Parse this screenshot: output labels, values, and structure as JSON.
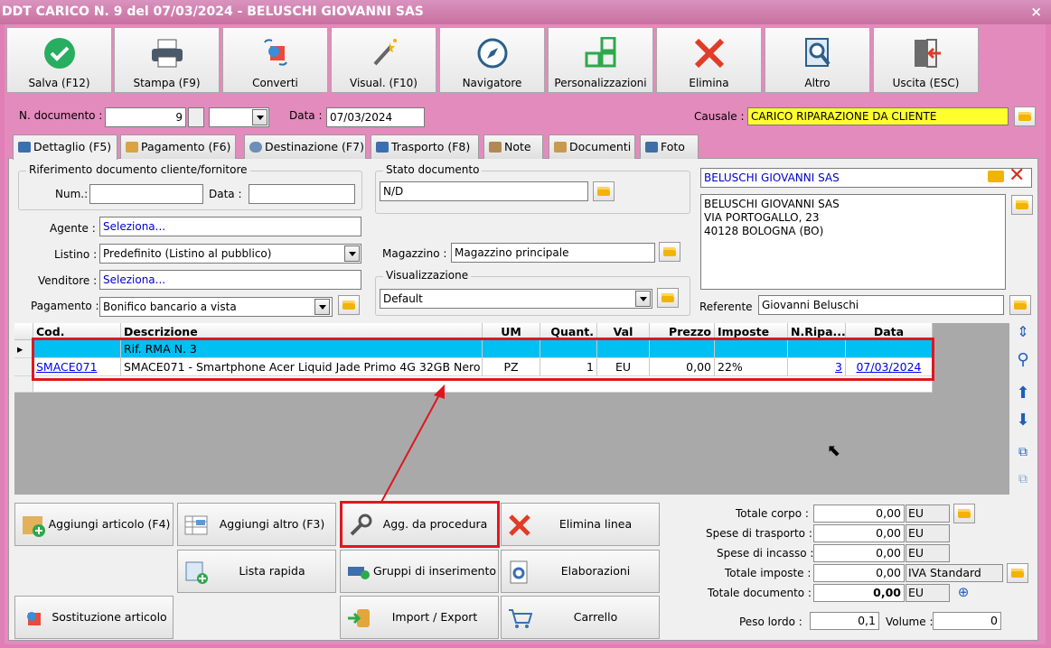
{
  "window": {
    "title": "DDT CARICO N. 9 del 07/03/2024 - BELUSCHI GIOVANNI SAS",
    "close": "×"
  },
  "toolbar": {
    "salva": "Salva (F12)",
    "stampa": "Stampa (F9)",
    "converti": "Converti",
    "visual": "Visual. (F10)",
    "navigatore": "Navigatore",
    "personalizzazioni": "Personalizzazioni",
    "elimina": "Elimina",
    "altro": "Altro",
    "uscita": "Uscita (ESC)"
  },
  "header": {
    "ndoc_label": "N. documento :",
    "ndoc_value": "9",
    "data_label": "Data :",
    "data_value": "07/03/2024",
    "causale_label": "Causale :",
    "causale_value": "CARICO RIPARAZIONE DA CLIENTE"
  },
  "tabs": [
    "Dettaglio (F5)",
    "Pagamento (F6)",
    "Destinazione (F7)",
    "Trasporto (F8)",
    "Note",
    "Documenti",
    "Foto"
  ],
  "form": {
    "rif_title": "Riferimento documento cliente/fornitore",
    "num_label": "Num.:",
    "num_value": "",
    "rdata_label": "Data :",
    "rdata_value": "",
    "agente_label": "Agente :",
    "agente_value": "Seleziona...",
    "listino_label": "Listino :",
    "listino_value": "Predefinito (Listino al pubblico)",
    "venditore_label": "Venditore :",
    "venditore_value": "Seleziona...",
    "pagamento_label": "Pagamento :",
    "pagamento_value": "Bonifico bancario a vista",
    "stato_title": "Stato documento",
    "stato_value": "N/D",
    "magazzino_label": "Magazzino :",
    "magazzino_value": "Magazzino principale",
    "visual_title": "Visualizzazione",
    "visual_value": "Default",
    "cliente_name": "BELUSCHI GIOVANNI SAS",
    "address_line1": "BELUSCHI GIOVANNI SAS",
    "address_line2": "VIA PORTOGALLO, 23",
    "address_line3": "40128 BOLOGNA (BO)",
    "referente_label": "Referente",
    "referente_value": "Giovanni Beluschi"
  },
  "grid": {
    "columns": [
      "Cod.",
      "Descrizione",
      "UM",
      "Quant.",
      "Val",
      "Prezzo",
      "Imposte",
      "N.Ripa...",
      "Data"
    ],
    "rows": [
      {
        "cod": "",
        "descr": "Rif. RMA N. 3",
        "um": "",
        "quant": "",
        "val": "",
        "prezzo": "",
        "imposte": "",
        "nrip": "",
        "data": ""
      },
      {
        "cod": "SMACE071",
        "descr": "SMACE071 - Smartphone Acer Liquid Jade Primo 4G 32GB Nero",
        "um": "PZ",
        "quant": "1",
        "val": "EU",
        "prezzo": "0,00",
        "imposte": "22%",
        "nrip": "3",
        "data": "07/03/2024"
      }
    ]
  },
  "buttons": {
    "aggiungi_articolo": "Aggiungi articolo (F4)",
    "aggiungi_altro": "Aggiungi altro (F3)",
    "agg_procedura": "Agg. da procedura",
    "elimina_linea": "Elimina linea",
    "lista_rapida": "Lista rapida",
    "gruppi": "Gruppi di inserimento",
    "elaborazioni": "Elaborazioni",
    "sostituzione": "Sostituzione articolo",
    "import_export": "Import / Export",
    "carrello": "Carrello"
  },
  "totals": {
    "corpo_label": "Totale corpo :",
    "corpo_value": "0,00",
    "corpo_cur": "EU",
    "trasporto_label": "Spese di trasporto :",
    "trasporto_value": "0,00",
    "trasporto_cur": "EU",
    "incasso_label": "Spese di incasso :",
    "incasso_value": "0,00",
    "incasso_cur": "EU",
    "imposte_label": "Totale imposte :",
    "imposte_value": "0,00",
    "imposte_cur": "IVA Standard",
    "documento_label": "Totale documento :",
    "documento_value": "0,00",
    "documento_cur": "EU",
    "peso_label": "Peso lordo :",
    "peso_value": "0,1",
    "volume_label": "Volume :",
    "volume_value": "0"
  }
}
